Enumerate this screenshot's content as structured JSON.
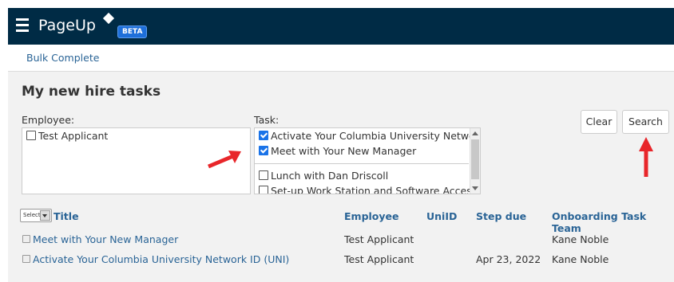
{
  "header": {
    "logo_text": "PageUp",
    "badge": "BETA",
    "bg_color": "#002b45"
  },
  "subnav": {
    "link": "Bulk Complete"
  },
  "main": {
    "title": "My new hire tasks",
    "employee_label": "Employee:",
    "employee_options": [
      {
        "label": "Test Applicant",
        "checked": false
      }
    ],
    "task_label": "Task:",
    "task_options": [
      {
        "label": "Activate Your Columbia University Network ID",
        "checked": true
      },
      {
        "label": "Meet with Your New Manager",
        "checked": true
      },
      {
        "label": "Lunch with Dan Driscoll",
        "checked": false
      },
      {
        "label": "Set-up Work Station and Software Access",
        "checked": false
      }
    ],
    "clear_label": "Clear",
    "search_label": "Search"
  },
  "table": {
    "select_label": "Select",
    "columns": [
      "Title",
      "Employee",
      "UniID",
      "Step due",
      "Onboarding Task Team"
    ],
    "rows": [
      {
        "title": "Meet with Your New Manager",
        "employee": "Test Applicant",
        "uniid": "",
        "step_due": "",
        "team": "Kane Noble"
      },
      {
        "title": "Activate Your Columbia University Network ID (UNI)",
        "employee": "Test Applicant",
        "uniid": "",
        "step_due": "Apr 23, 2022",
        "team": "Kane Noble"
      }
    ]
  },
  "annotation_color": "#e8262a"
}
